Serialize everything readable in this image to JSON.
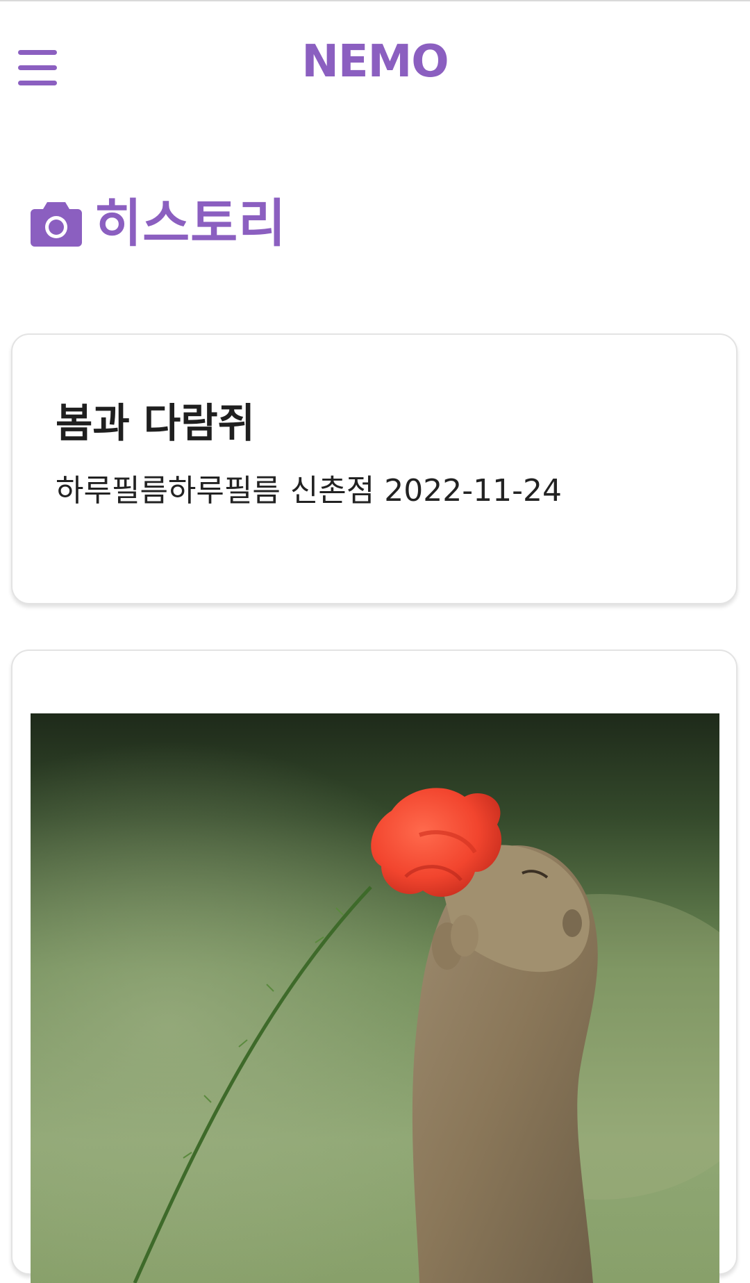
{
  "header": {
    "app_title": "NEMO",
    "menu_icon": "hamburger-menu-icon",
    "accent_color": "#8b5fc0"
  },
  "section": {
    "icon": "camera-icon",
    "title": "히스토리"
  },
  "history_items": [
    {
      "title": "봄과 다람쥐",
      "place": "하루필름하루필름 신촌점",
      "date": "2022-11-24"
    }
  ],
  "photo": {
    "icon": "photo-squirrel-with-red-poppy"
  }
}
